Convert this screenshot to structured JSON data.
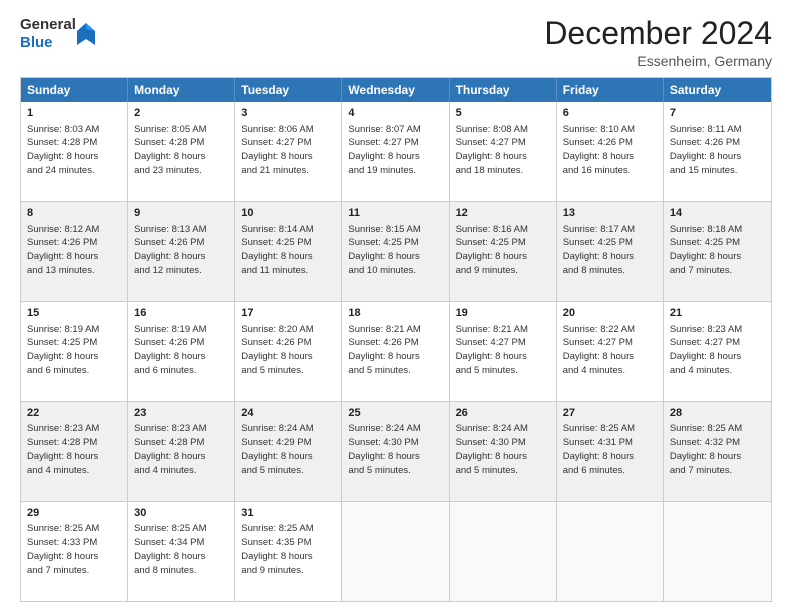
{
  "logo": {
    "general": "General",
    "blue": "Blue"
  },
  "title": "December 2024",
  "subtitle": "Essenheim, Germany",
  "days": [
    "Sunday",
    "Monday",
    "Tuesday",
    "Wednesday",
    "Thursday",
    "Friday",
    "Saturday"
  ],
  "weeks": [
    [
      {
        "day": "1",
        "text": "Sunrise: 8:03 AM\nSunset: 4:28 PM\nDaylight: 8 hours\nand 24 minutes."
      },
      {
        "day": "2",
        "text": "Sunrise: 8:05 AM\nSunset: 4:28 PM\nDaylight: 8 hours\nand 23 minutes."
      },
      {
        "day": "3",
        "text": "Sunrise: 8:06 AM\nSunset: 4:27 PM\nDaylight: 8 hours\nand 21 minutes."
      },
      {
        "day": "4",
        "text": "Sunrise: 8:07 AM\nSunset: 4:27 PM\nDaylight: 8 hours\nand 19 minutes."
      },
      {
        "day": "5",
        "text": "Sunrise: 8:08 AM\nSunset: 4:27 PM\nDaylight: 8 hours\nand 18 minutes."
      },
      {
        "day": "6",
        "text": "Sunrise: 8:10 AM\nSunset: 4:26 PM\nDaylight: 8 hours\nand 16 minutes."
      },
      {
        "day": "7",
        "text": "Sunrise: 8:11 AM\nSunset: 4:26 PM\nDaylight: 8 hours\nand 15 minutes."
      }
    ],
    [
      {
        "day": "8",
        "text": "Sunrise: 8:12 AM\nSunset: 4:26 PM\nDaylight: 8 hours\nand 13 minutes."
      },
      {
        "day": "9",
        "text": "Sunrise: 8:13 AM\nSunset: 4:26 PM\nDaylight: 8 hours\nand 12 minutes."
      },
      {
        "day": "10",
        "text": "Sunrise: 8:14 AM\nSunset: 4:25 PM\nDaylight: 8 hours\nand 11 minutes."
      },
      {
        "day": "11",
        "text": "Sunrise: 8:15 AM\nSunset: 4:25 PM\nDaylight: 8 hours\nand 10 minutes."
      },
      {
        "day": "12",
        "text": "Sunrise: 8:16 AM\nSunset: 4:25 PM\nDaylight: 8 hours\nand 9 minutes."
      },
      {
        "day": "13",
        "text": "Sunrise: 8:17 AM\nSunset: 4:25 PM\nDaylight: 8 hours\nand 8 minutes."
      },
      {
        "day": "14",
        "text": "Sunrise: 8:18 AM\nSunset: 4:25 PM\nDaylight: 8 hours\nand 7 minutes."
      }
    ],
    [
      {
        "day": "15",
        "text": "Sunrise: 8:19 AM\nSunset: 4:25 PM\nDaylight: 8 hours\nand 6 minutes."
      },
      {
        "day": "16",
        "text": "Sunrise: 8:19 AM\nSunset: 4:26 PM\nDaylight: 8 hours\nand 6 minutes."
      },
      {
        "day": "17",
        "text": "Sunrise: 8:20 AM\nSunset: 4:26 PM\nDaylight: 8 hours\nand 5 minutes."
      },
      {
        "day": "18",
        "text": "Sunrise: 8:21 AM\nSunset: 4:26 PM\nDaylight: 8 hours\nand 5 minutes."
      },
      {
        "day": "19",
        "text": "Sunrise: 8:21 AM\nSunset: 4:27 PM\nDaylight: 8 hours\nand 5 minutes."
      },
      {
        "day": "20",
        "text": "Sunrise: 8:22 AM\nSunset: 4:27 PM\nDaylight: 8 hours\nand 4 minutes."
      },
      {
        "day": "21",
        "text": "Sunrise: 8:23 AM\nSunset: 4:27 PM\nDaylight: 8 hours\nand 4 minutes."
      }
    ],
    [
      {
        "day": "22",
        "text": "Sunrise: 8:23 AM\nSunset: 4:28 PM\nDaylight: 8 hours\nand 4 minutes."
      },
      {
        "day": "23",
        "text": "Sunrise: 8:23 AM\nSunset: 4:28 PM\nDaylight: 8 hours\nand 4 minutes."
      },
      {
        "day": "24",
        "text": "Sunrise: 8:24 AM\nSunset: 4:29 PM\nDaylight: 8 hours\nand 5 minutes."
      },
      {
        "day": "25",
        "text": "Sunrise: 8:24 AM\nSunset: 4:30 PM\nDaylight: 8 hours\nand 5 minutes."
      },
      {
        "day": "26",
        "text": "Sunrise: 8:24 AM\nSunset: 4:30 PM\nDaylight: 8 hours\nand 5 minutes."
      },
      {
        "day": "27",
        "text": "Sunrise: 8:25 AM\nSunset: 4:31 PM\nDaylight: 8 hours\nand 6 minutes."
      },
      {
        "day": "28",
        "text": "Sunrise: 8:25 AM\nSunset: 4:32 PM\nDaylight: 8 hours\nand 7 minutes."
      }
    ],
    [
      {
        "day": "29",
        "text": "Sunrise: 8:25 AM\nSunset: 4:33 PM\nDaylight: 8 hours\nand 7 minutes."
      },
      {
        "day": "30",
        "text": "Sunrise: 8:25 AM\nSunset: 4:34 PM\nDaylight: 8 hours\nand 8 minutes."
      },
      {
        "day": "31",
        "text": "Sunrise: 8:25 AM\nSunset: 4:35 PM\nDaylight: 8 hours\nand 9 minutes."
      },
      {
        "day": "",
        "text": ""
      },
      {
        "day": "",
        "text": ""
      },
      {
        "day": "",
        "text": ""
      },
      {
        "day": "",
        "text": ""
      }
    ]
  ]
}
